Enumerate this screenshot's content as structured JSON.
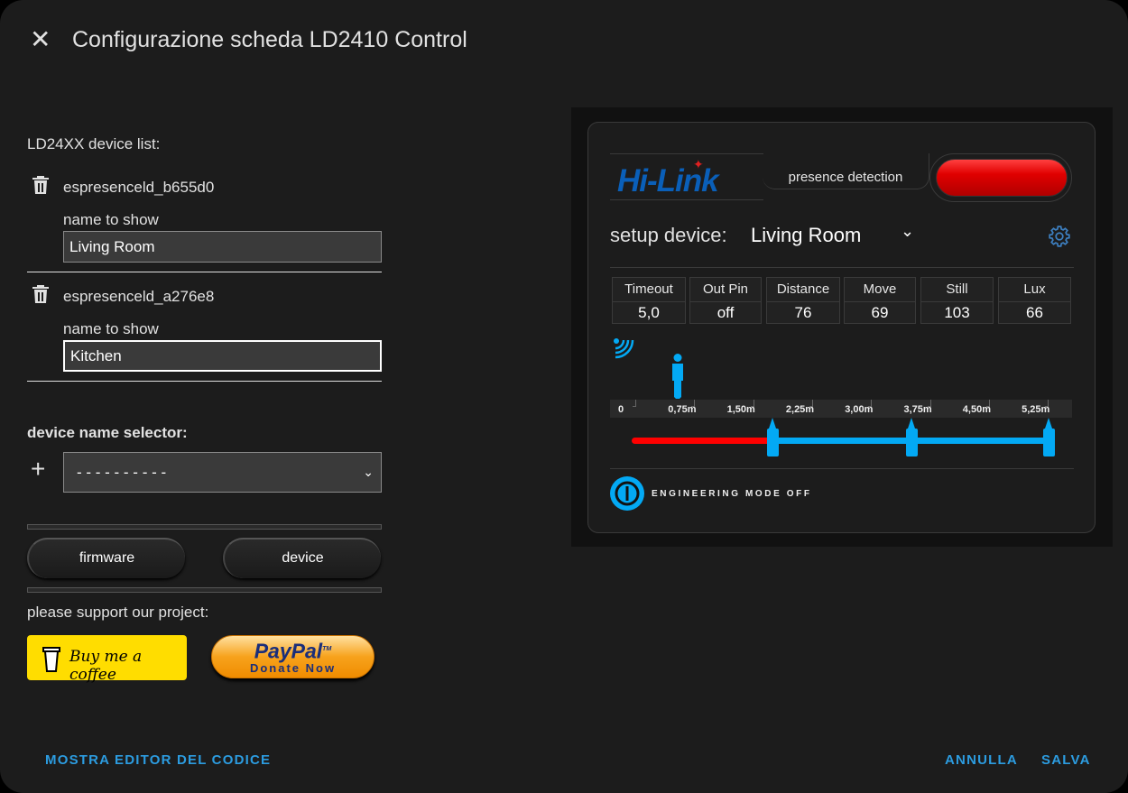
{
  "dialog": {
    "title": "Configurazione scheda LD2410 Control",
    "close_icon": "close-icon"
  },
  "left": {
    "device_list_label": "LD24XX device list:",
    "devices": [
      {
        "id": "espresenceld_b655d0",
        "name_label": "name to show",
        "name_value": "Living Room"
      },
      {
        "id": "espresenceld_a276e8",
        "name_label": "name to show",
        "name_value": "Kitchen"
      }
    ],
    "selector_label": "device name selector:",
    "selector_value": "- - - - - - - - - -",
    "firmware_button": "firmware",
    "device_button": "device",
    "support_label": "please support our project:",
    "coffee_button": "Buy me a coffee",
    "paypal_brand": "PayPal",
    "paypal_tm": "TM",
    "paypal_action": "Donate Now"
  },
  "card": {
    "logo": "Hi-Link",
    "presence_label": "presence detection",
    "presence_state_color": "#e00000",
    "setup_label": "setup device:",
    "setup_value": "Living Room",
    "stats": [
      {
        "label": "Timeout",
        "value": "5,0"
      },
      {
        "label": "Out Pin",
        "value": "off"
      },
      {
        "label": "Distance",
        "value": "76"
      },
      {
        "label": "Move",
        "value": "69"
      },
      {
        "label": "Still",
        "value": "103"
      },
      {
        "label": "Lux",
        "value": "66"
      }
    ],
    "ruler_ticks": [
      "0",
      "0,75m",
      "1,50m",
      "2,25m",
      "3,00m",
      "3,75m",
      "4,50m",
      "5,25m"
    ],
    "person_distance_m": 0.76,
    "range_handles_m": [
      2.25,
      3.75,
      6.0
    ],
    "engineering_mode": "ENGINEERING MODE OFF",
    "accent": "#03a9f4"
  },
  "footer": {
    "code_editor": "MOSTRA EDITOR DEL CODICE",
    "cancel": "ANNULLA",
    "save": "SALVA"
  }
}
